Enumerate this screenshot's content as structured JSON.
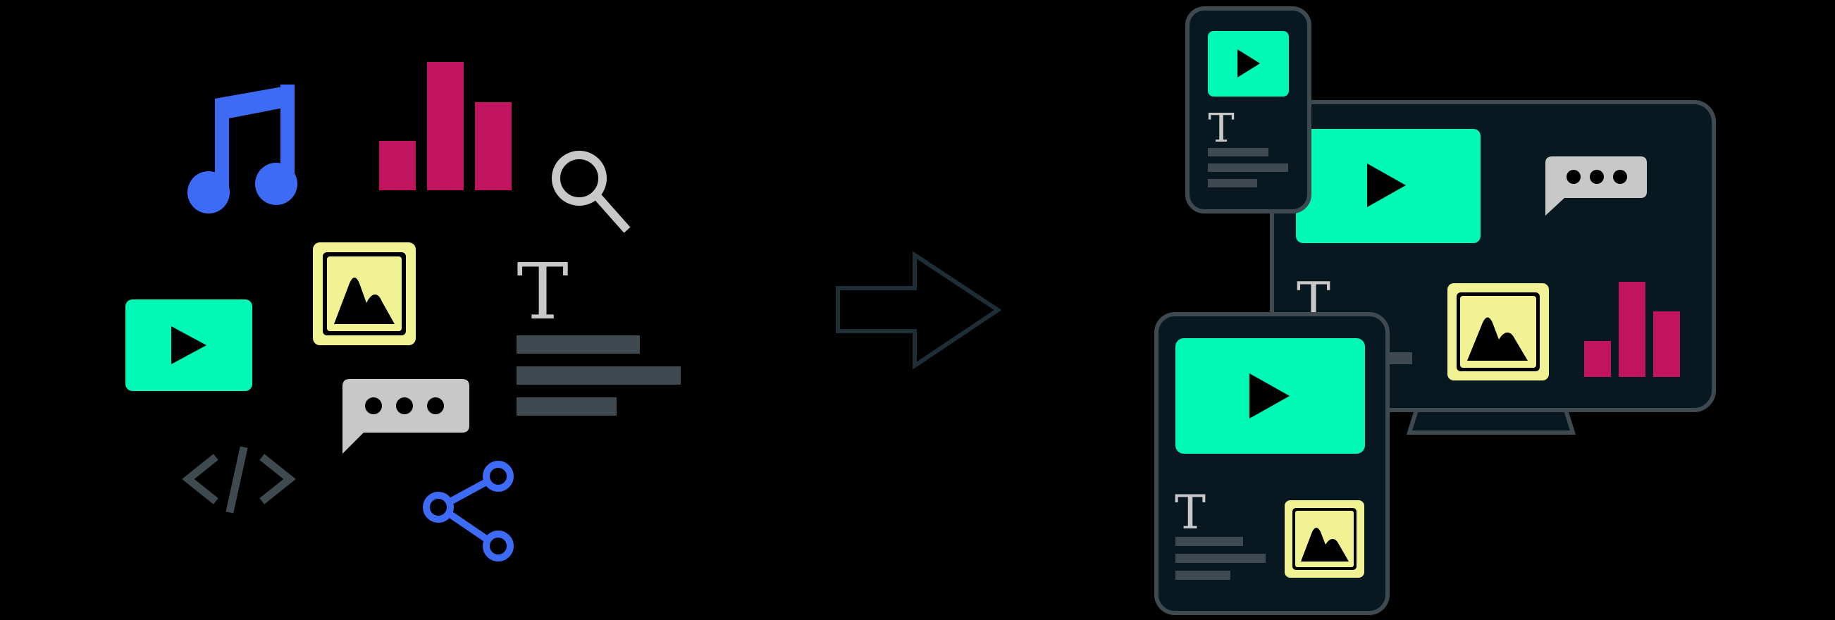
{
  "colors": {
    "background": "#000000",
    "teal": "#00f9b4",
    "blue": "#3e6bf5",
    "magenta": "#c0145e",
    "yellow": "#f0f294",
    "gray": "#c8c8c8",
    "dark_gray": "#3f4a50",
    "device_fill": "#071820",
    "device_stroke": "#3f4a50",
    "arrow_stroke": "#1f2e36"
  },
  "icons": {
    "music": "music-note-icon",
    "bars": "bar-chart-icon",
    "search": "magnifier-icon",
    "video": "play-icon",
    "image": "image-icon",
    "text": "text-T-icon",
    "chat": "chat-bubble-icon",
    "code": "code-brackets-icon",
    "share": "share-icon",
    "arrow": "right-arrow-icon",
    "phone": "phone-device",
    "tablet": "tablet-device",
    "tv": "tv-device"
  },
  "glyphs": {
    "text_T": "T"
  }
}
